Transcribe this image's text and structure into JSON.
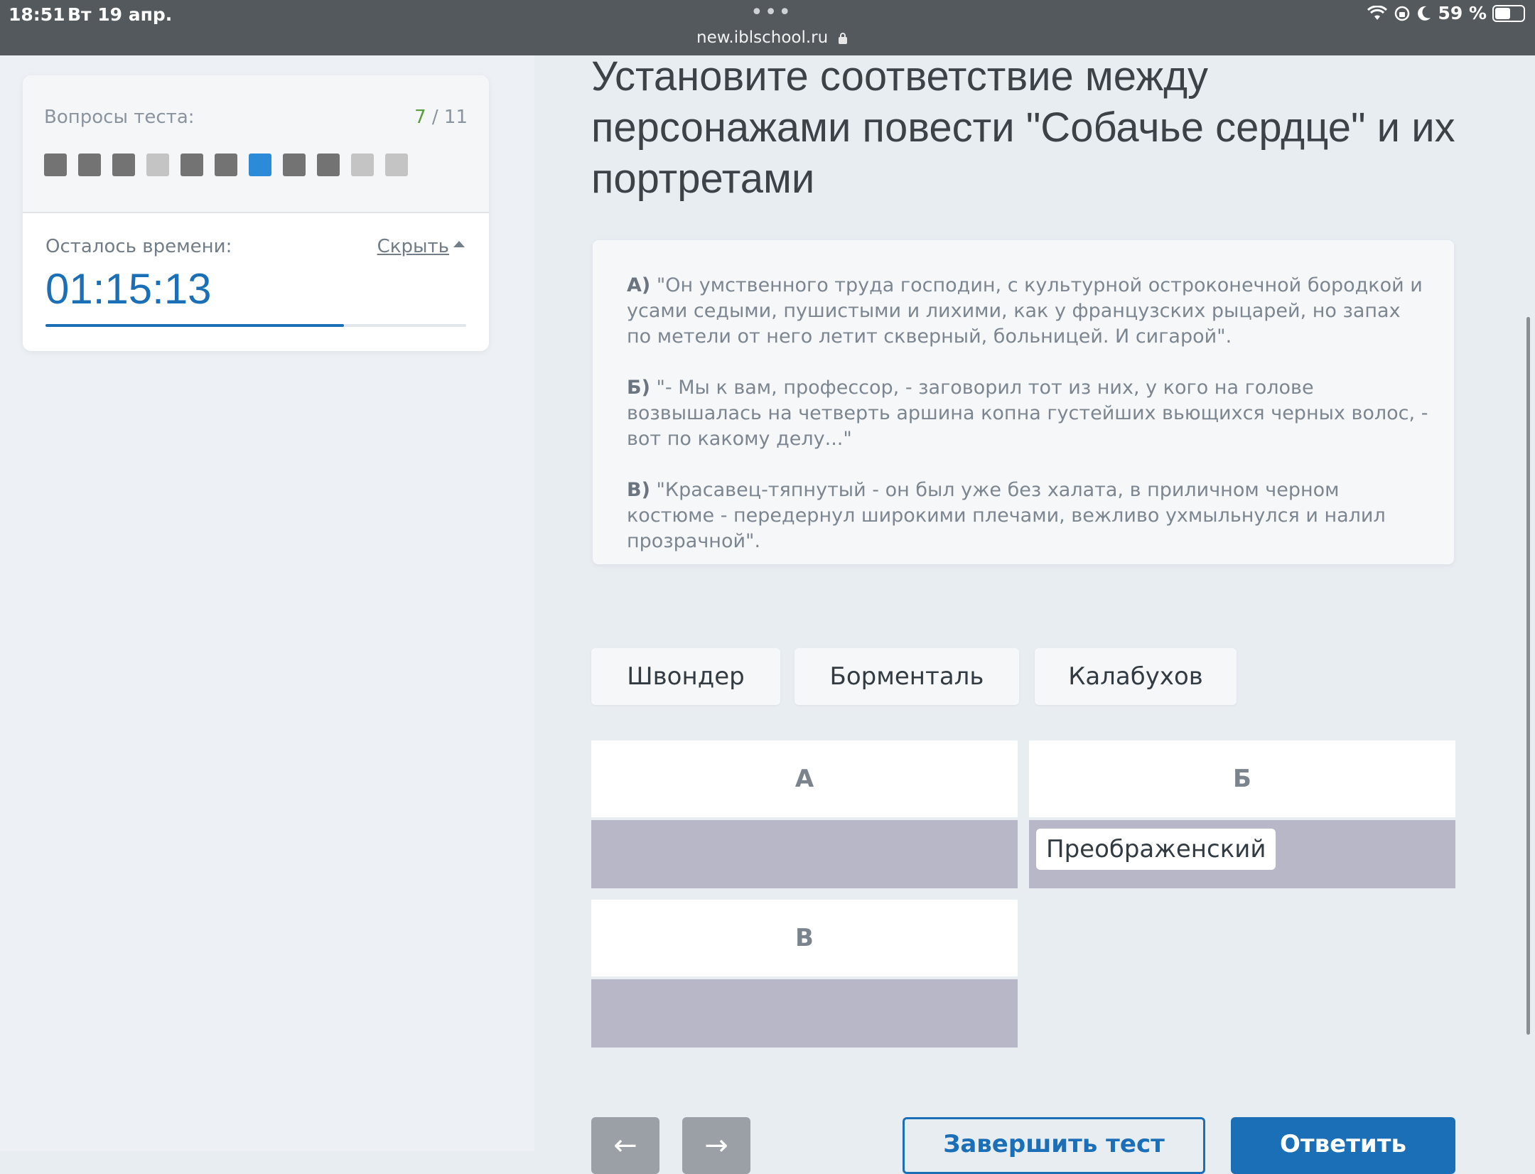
{
  "status_bar": {
    "time": "18:51",
    "date": "Вт 19 апр.",
    "dots": "•••",
    "url": "new.iblschool.ru",
    "battery_text": "59 %",
    "battery_level": 0.59
  },
  "sidebar": {
    "questions_label": "Вопросы теста:",
    "current": "7",
    "separator": " / ",
    "total": "11",
    "squares": [
      "done",
      "done",
      "done",
      "empty",
      "done",
      "done",
      "active",
      "done",
      "done",
      "empty",
      "empty"
    ],
    "timer_label": "Осталось времени:",
    "hide_label": "Скрыть",
    "timer_value": "01:15:13",
    "timer_progress": 0.71
  },
  "question": {
    "title": "Установите соответствие между персонажами повести \"Собачье сердце\" и их портретами"
  },
  "passages": [
    {
      "key": "А)",
      "text": " \"Он умственного труда господин, с культурной остроконечной бородкой и усами седыми, пушистыми и лихими, как у французских рыцарей, но запах по метели от него летит скверный, больницей. И сигарой\"."
    },
    {
      "key": "Б)",
      "text": " \"- Мы к вам, профессор, - заговорил тот из них, у кого на голове возвышалась на четверть аршина копна густейших вьющихся черных волос, - вот по какому делу...\""
    },
    {
      "key": "В)",
      "text": " \"Красавец-тяпнутый - он был уже без халата, в приличном черном костюме - передернул широкими плечами, вежливо ухмыльнулся и налил прозрачной\"."
    }
  ],
  "options": [
    "Швондер",
    "Борменталь",
    "Калабухов"
  ],
  "slots": [
    {
      "label": "А",
      "value": ""
    },
    {
      "label": "Б",
      "value": "Преображенский"
    },
    {
      "label": "В",
      "value": ""
    }
  ],
  "buttons": {
    "prev": "←",
    "next": "→",
    "finish": "Завершить тест",
    "answer": "Ответить"
  },
  "colors": {
    "accent": "#1b6fb6",
    "active_square": "#2b8bd8",
    "done_square": "#737373",
    "empty_square": "#c4c4c4",
    "drop_zone": "#b8b7c8",
    "current_count": "#5a9e3c"
  }
}
